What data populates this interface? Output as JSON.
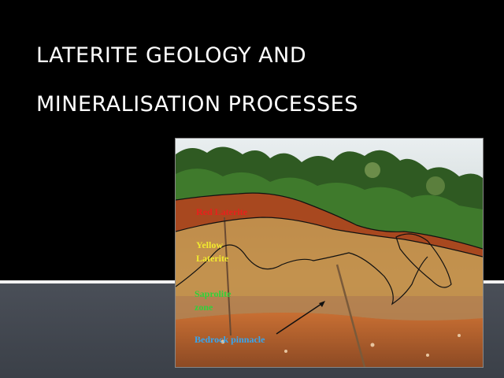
{
  "slide": {
    "title_line1": "LATERITE GEOLOGY AND",
    "title_line2": "MINERALISATION PROCESSES"
  },
  "figure": {
    "labels": {
      "red_laterite": "Red Laterite",
      "yellow_laterite_1": "Yellow",
      "yellow_laterite_2": "Laterite",
      "saprolite_1": "Saprolite",
      "saprolite_2": "zone",
      "bedrock": "Bedrock pinnacle"
    },
    "colors": {
      "red_laterite": "#e8201c",
      "yellow_laterite": "#f2ea2e",
      "saprolite": "#2fd13a",
      "bedrock": "#36a6f0"
    }
  },
  "theme": {
    "background_top": "#000000",
    "background_bottom": "#474b52",
    "title_color": "#ffffff"
  }
}
